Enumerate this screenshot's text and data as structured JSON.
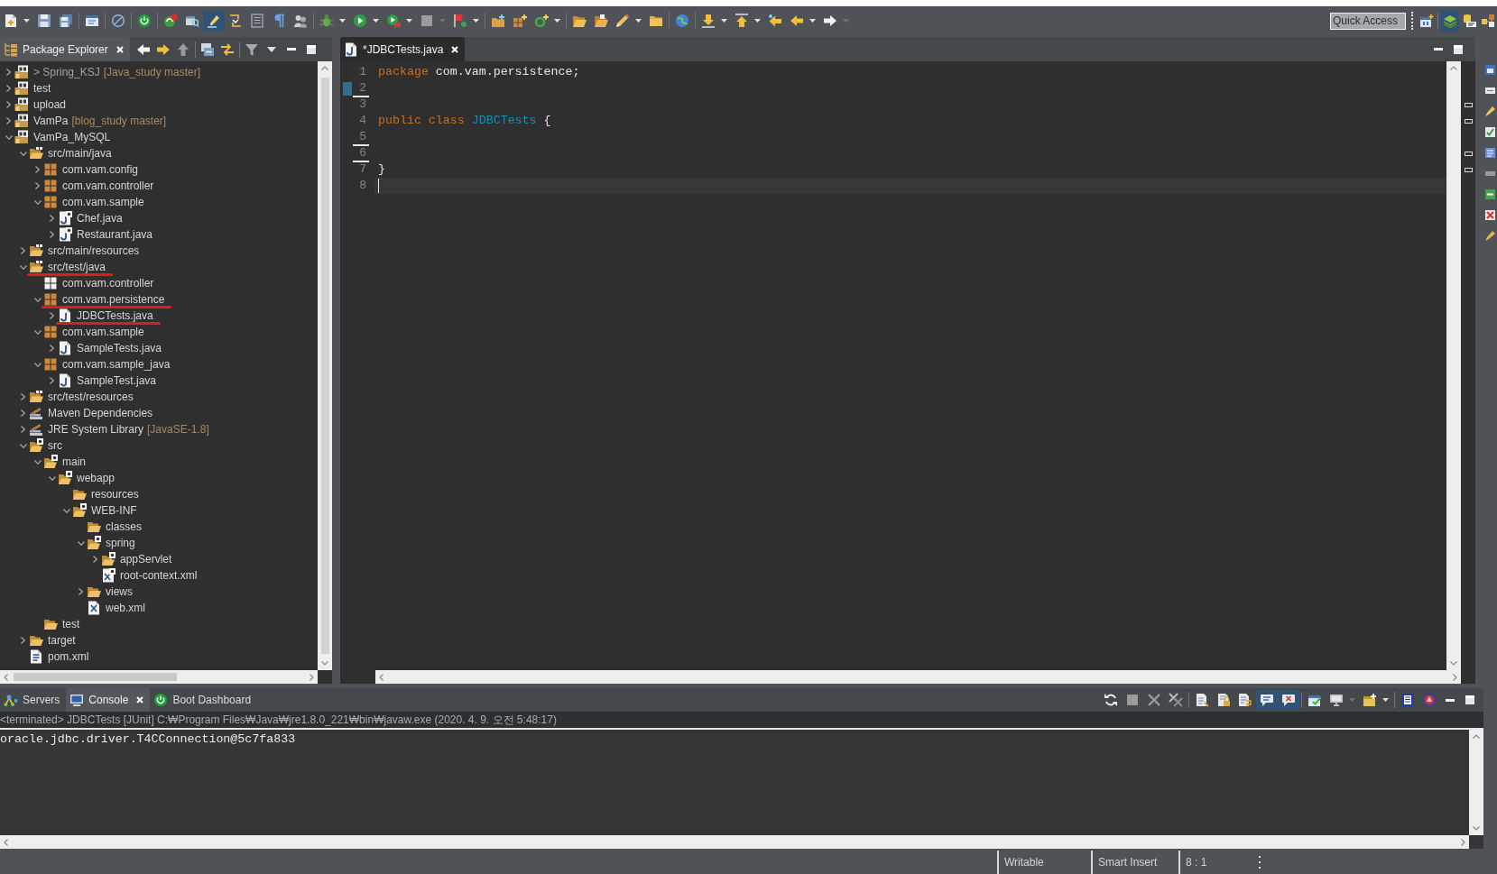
{
  "toolbar": {
    "groups": [
      {
        "items": [
          {
            "kind": "new-file",
            "pressed": false,
            "dropdown": true,
            "dropdown_enabled": true
          },
          {
            "kind": "save",
            "pressed": false,
            "dropdown": false
          },
          {
            "kind": "save-all",
            "pressed": false,
            "dropdown": false
          }
        ]
      },
      {
        "items": [
          {
            "kind": "window",
            "pressed": false,
            "dropdown": false
          }
        ]
      },
      {
        "items": [
          {
            "kind": "skip",
            "pressed": false,
            "dropdown": false
          }
        ]
      },
      {
        "items": [
          {
            "kind": "power",
            "pressed": false,
            "dropdown": false
          }
        ]
      },
      {
        "items": [
          {
            "kind": "update",
            "pressed": false,
            "dropdown": false
          },
          {
            "kind": "open-type",
            "pressed": false,
            "dropdown": false
          },
          {
            "kind": "highlighter",
            "pressed": true,
            "dropdown": false
          },
          {
            "kind": "block",
            "pressed": false,
            "dropdown": false
          },
          {
            "kind": "block-select",
            "pressed": false,
            "dropdown": false
          },
          {
            "kind": "paragraph",
            "pressed": false,
            "dropdown": false
          },
          {
            "kind": "people",
            "pressed": false,
            "dropdown": false
          }
        ]
      },
      {
        "items": [
          {
            "kind": "bug",
            "pressed": false,
            "dropdown": true,
            "dropdown_enabled": true
          },
          {
            "kind": "run",
            "pressed": false,
            "dropdown": true,
            "dropdown_enabled": true
          },
          {
            "kind": "coverage",
            "pressed": false,
            "dropdown": true,
            "dropdown_enabled": true
          },
          {
            "kind": "stop",
            "pressed": false,
            "dropdown": true,
            "dropdown_enabled": false
          },
          {
            "kind": "flag",
            "pressed": false,
            "dropdown": true,
            "dropdown_enabled": true
          }
        ]
      },
      {
        "items": [
          {
            "kind": "new-project",
            "pressed": false,
            "dropdown": false
          },
          {
            "kind": "new-package",
            "pressed": false,
            "dropdown": false
          },
          {
            "kind": "new-class",
            "pressed": false,
            "dropdown": true,
            "dropdown_enabled": true
          }
        ]
      },
      {
        "items": [
          {
            "kind": "open-project",
            "pressed": false,
            "dropdown": false
          },
          {
            "kind": "open-file",
            "pressed": false,
            "dropdown": false
          },
          {
            "kind": "edit",
            "pressed": false,
            "dropdown": true,
            "dropdown_enabled": true
          },
          {
            "kind": "open-resource",
            "pressed": false,
            "dropdown": false
          }
        ]
      },
      {
        "items": [
          {
            "kind": "globe",
            "pressed": false,
            "dropdown": false
          }
        ]
      },
      {
        "items": [
          {
            "kind": "next-annotation",
            "pressed": false,
            "dropdown": true,
            "dropdown_enabled": true
          },
          {
            "kind": "prev-annotation",
            "pressed": false,
            "dropdown": true,
            "dropdown_enabled": true
          },
          {
            "kind": "last-edit",
            "pressed": false,
            "dropdown": false
          },
          {
            "kind": "back",
            "pressed": false,
            "dropdown": true,
            "dropdown_enabled": true
          },
          {
            "kind": "forward",
            "pressed": false,
            "dropdown": true,
            "dropdown_enabled": false
          }
        ]
      }
    ],
    "quick_access": {
      "placeholder": "Quick Access"
    },
    "perspectives": [
      {
        "kind": "open-perspective",
        "selected": false
      },
      {
        "kind": "java-ee",
        "selected": true
      },
      {
        "kind": "git",
        "selected": false
      },
      {
        "kind": "debug-perspective",
        "selected": false
      }
    ]
  },
  "package_explorer": {
    "tabs": [
      {
        "kind": "package-explorer",
        "label": "Package Explorer",
        "selected": true
      }
    ],
    "toolbar": {
      "groups": [
        {
          "items": [
            {
              "kind": "back-white"
            },
            {
              "kind": "forward-yellow"
            },
            {
              "kind": "up"
            }
          ]
        },
        {
          "items": [
            {
              "kind": "collapse-all"
            },
            {
              "kind": "link-editor"
            }
          ]
        },
        {
          "items": [
            {
              "kind": "filter"
            },
            {
              "kind": "view-menu"
            },
            {
              "kind": "minimize"
            },
            {
              "kind": "maximize"
            }
          ]
        }
      ]
    },
    "tree": [
      {
        "kind": "project",
        "label": "> Spring_KSJ",
        "decoration": "[Java_study master]",
        "expanded": false,
        "dirty": true,
        "marked": false
      },
      {
        "kind": "project",
        "label": "test",
        "expanded": false,
        "dirty": false,
        "marked": false
      },
      {
        "kind": "project",
        "label": "upload",
        "expanded": false,
        "dirty": false,
        "marked": false
      },
      {
        "kind": "project",
        "label": "VamPa",
        "decoration": "[blog_study master]",
        "expanded": false,
        "dirty": false,
        "marked": false
      },
      {
        "kind": "project",
        "label": "VamPa_MySQL",
        "expanded": true,
        "dirty": false,
        "marked": false,
        "children": [
          {
            "kind": "source-folder",
            "label": "src/main/java",
            "expanded": true,
            "marked": false,
            "children": [
              {
                "kind": "package",
                "label": "com.vam.config",
                "expanded": false,
                "marked": false
              },
              {
                "kind": "package",
                "label": "com.vam.controller",
                "expanded": false,
                "marked": false
              },
              {
                "kind": "package",
                "label": "com.vam.sample",
                "expanded": true,
                "marked": false,
                "children": [
                  {
                    "kind": "spring-java-file",
                    "label": "Chef.java",
                    "expanded": false,
                    "marked": false
                  },
                  {
                    "kind": "spring-java-file",
                    "label": "Restaurant.java",
                    "expanded": false,
                    "marked": false
                  }
                ]
              }
            ]
          },
          {
            "kind": "source-folder",
            "label": "src/main/resources",
            "expanded": false,
            "marked": false
          },
          {
            "kind": "source-folder",
            "label": "src/test/java",
            "expanded": true,
            "marked": true,
            "children": [
              {
                "kind": "empty-package",
                "label": "com.vam.controller",
                "marked": false
              },
              {
                "kind": "package",
                "label": "com.vam.persistence",
                "expanded": true,
                "marked": true,
                "children": [
                  {
                    "kind": "java-file",
                    "label": "JDBCTests.java",
                    "expanded": false,
                    "marked": true
                  }
                ]
              },
              {
                "kind": "package",
                "label": "com.vam.sample",
                "expanded": true,
                "marked": false,
                "children": [
                  {
                    "kind": "java-file",
                    "label": "SampleTests.java",
                    "expanded": false,
                    "marked": false
                  }
                ]
              },
              {
                "kind": "package",
                "label": "com.vam.sample_java",
                "expanded": true,
                "marked": false,
                "children": [
                  {
                    "kind": "java-file",
                    "label": "SampleTest.java",
                    "expanded": false,
                    "marked": false
                  }
                ]
              }
            ]
          },
          {
            "kind": "source-folder",
            "label": "src/test/resources",
            "expanded": false,
            "marked": false
          },
          {
            "kind": "library",
            "label": "Maven Dependencies",
            "expanded": false,
            "marked": false
          },
          {
            "kind": "library",
            "label": "JRE System Library",
            "decoration": "[JavaSE-1.8]",
            "expanded": false,
            "marked": false
          },
          {
            "kind": "spring-folder",
            "label": "src",
            "expanded": true,
            "marked": false,
            "children": [
              {
                "kind": "spring-folder",
                "label": "main",
                "expanded": true,
                "marked": false,
                "children": [
                  {
                    "kind": "spring-folder",
                    "label": "webapp",
                    "expanded": true,
                    "marked": false,
                    "children": [
                      {
                        "kind": "folder",
                        "label": "resources",
                        "marked": false
                      },
                      {
                        "kind": "spring-folder",
                        "label": "WEB-INF",
                        "expanded": true,
                        "marked": false,
                        "children": [
                          {
                            "kind": "folder",
                            "label": "classes",
                            "marked": false
                          },
                          {
                            "kind": "spring-folder",
                            "label": "spring",
                            "expanded": true,
                            "marked": false,
                            "children": [
                              {
                                "kind": "spring-folder",
                                "label": "appServlet",
                                "expanded": false,
                                "marked": false
                              },
                              {
                                "kind": "spring-xml-file",
                                "label": "root-context.xml",
                                "marked": false
                              }
                            ]
                          },
                          {
                            "kind": "folder",
                            "label": "views",
                            "expanded": false,
                            "marked": false
                          },
                          {
                            "kind": "xml-file",
                            "label": "web.xml",
                            "marked": false
                          }
                        ]
                      }
                    ]
                  }
                ]
              },
              {
                "kind": "folder",
                "label": "test",
                "marked": false
              }
            ]
          },
          {
            "kind": "folder",
            "label": "target",
            "expanded": false,
            "marked": false
          },
          {
            "kind": "pom-file",
            "label": "pom.xml",
            "marked": false
          }
        ]
      }
    ]
  },
  "editor": {
    "tabs": [
      {
        "kind": "java-file",
        "label": "*JDBCTests.java",
        "selected": true
      }
    ],
    "toolbar": {
      "groups": [
        {
          "items": [
            {
              "kind": "minimize"
            },
            {
              "kind": "maximize"
            }
          ]
        }
      ]
    },
    "lines": [
      {
        "number": "1",
        "tokens": [
          {
            "kind": "keyword",
            "text": "package"
          },
          {
            "kind": "plain",
            "text": " com.vam.persistence;"
          }
        ],
        "current": false,
        "changed": false,
        "deleted_after": false,
        "overview": false
      },
      {
        "number": "2",
        "current": false,
        "changed": true,
        "deleted_after": true,
        "overview": false
      },
      {
        "number": "3",
        "current": false,
        "changed": false,
        "deleted_after": false,
        "overview": true
      },
      {
        "number": "4",
        "tokens": [
          {
            "kind": "keyword",
            "text": "public class"
          },
          {
            "kind": "type",
            "text": " JDBCTests"
          },
          {
            "kind": "plain",
            "text": " {"
          }
        ],
        "current": false,
        "changed": false,
        "deleted_after": false,
        "overview": true
      },
      {
        "number": "5",
        "current": false,
        "changed": false,
        "deleted_after": true,
        "overview": false
      },
      {
        "number": "6",
        "current": false,
        "changed": false,
        "deleted_after": true,
        "overview": true
      },
      {
        "number": "7",
        "tokens": [
          {
            "kind": "plain",
            "text": "}"
          }
        ],
        "current": false,
        "changed": false,
        "deleted_after": false,
        "overview": true
      },
      {
        "number": "8",
        "current": true,
        "changed": false,
        "deleted_after": false,
        "overview": false
      }
    ]
  },
  "bottom_panel": {
    "tabs": [
      {
        "kind": "servers",
        "label": "Servers",
        "selected": false
      },
      {
        "kind": "console",
        "label": "Console",
        "selected": true
      },
      {
        "kind": "boot-dashboard",
        "label": "Boot Dashboard",
        "selected": false
      }
    ],
    "toolbar": {
      "groups": [
        {
          "items": [
            {
              "kind": "refresh",
              "pressed": false,
              "dropdown": false
            },
            {
              "kind": "stop",
              "pressed": false,
              "dropdown": false
            },
            {
              "kind": "remove",
              "pressed": false,
              "dropdown": false
            },
            {
              "kind": "remove-all",
              "pressed": false,
              "dropdown": false
            }
          ]
        },
        {
          "items": [
            {
              "kind": "clear",
              "pressed": false,
              "dropdown": false
            },
            {
              "kind": "scroll-lock",
              "pressed": false,
              "dropdown": false
            },
            {
              "kind": "word-wrap",
              "pressed": false,
              "dropdown": false
            },
            {
              "kind": "show-out",
              "pressed": true,
              "dropdown": false
            },
            {
              "kind": "show-err",
              "pressed": true,
              "dropdown": false
            }
          ]
        },
        {
          "items": [
            {
              "kind": "pin",
              "pressed": false,
              "dropdown": false
            },
            {
              "kind": "display",
              "pressed": false,
              "dropdown": true,
              "dropdown_enabled": false
            },
            {
              "kind": "open-console",
              "pressed": false,
              "dropdown": true,
              "dropdown_enabled": true
            }
          ]
        },
        {
          "items": [
            {
              "kind": "doc-blue",
              "pressed": false,
              "dropdown": false
            },
            {
              "kind": "red-globe",
              "pressed": false,
              "dropdown": false
            },
            {
              "kind": "minimize",
              "pressed": false,
              "dropdown": false
            },
            {
              "kind": "maximize",
              "pressed": false,
              "dropdown": false
            }
          ]
        }
      ]
    },
    "header": "<terminated> JDBCTests [JUnit] C:₩Program Files₩Java₩jre1.8.0_221₩bin₩javaw.exe (2020. 4. 9. 오전 5:48:17)",
    "output": [
      "oracle.jdbc.driver.T4CConnection@5c7fa833"
    ]
  },
  "status_bar": {
    "items": [
      "Writable",
      "Smart Insert",
      "8 : 1"
    ]
  }
}
